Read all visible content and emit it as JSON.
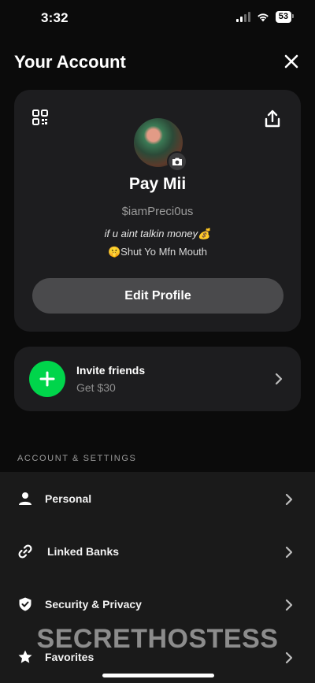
{
  "status_bar": {
    "time": "3:32",
    "battery": "53"
  },
  "header": {
    "title": "Your Account"
  },
  "profile": {
    "display_name": "Pay Mii",
    "cashtag": "$iamPreci0us",
    "bio_line1": "if u aint talkin money💰",
    "bio_line2": "🤫Shut Yo Mfn Mouth",
    "edit_button": "Edit Profile"
  },
  "invite": {
    "title": "Invite friends",
    "subtitle": "Get $30"
  },
  "settings": {
    "section_label": "ACCOUNT & SETTINGS",
    "items": [
      {
        "label": "Personal",
        "icon": "person-icon"
      },
      {
        "label": "Linked Banks",
        "icon": "link-icon"
      },
      {
        "label": "Security & Privacy",
        "icon": "shield-icon"
      },
      {
        "label": "Favorites",
        "icon": "star-icon"
      }
    ]
  },
  "watermark": "SECRETHOSTESS",
  "colors": {
    "accent_green": "#00d54b",
    "card_bg": "#1d1d1f",
    "page_bg": "#0b0b0b"
  }
}
